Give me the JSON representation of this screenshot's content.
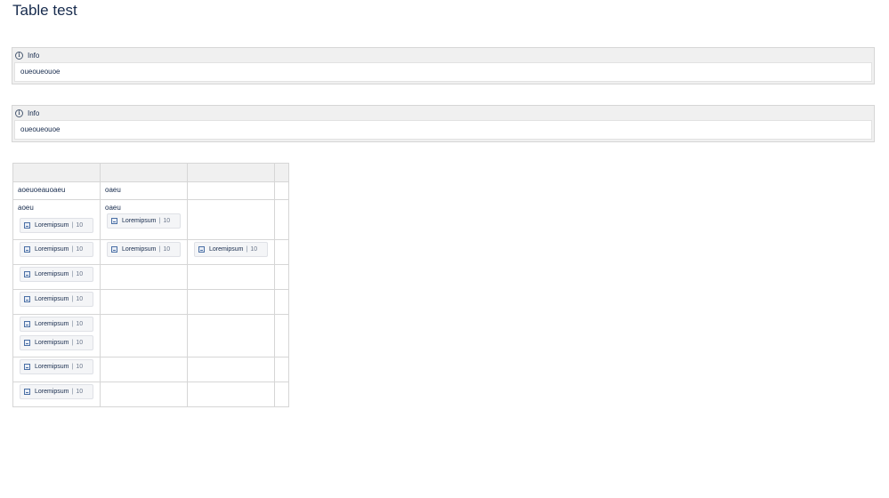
{
  "page": {
    "title": "Table test"
  },
  "panels": [
    {
      "header": "Info",
      "body": "oueoueouoe"
    },
    {
      "header": "Info",
      "body": "oueoueouoe"
    }
  ],
  "table": {
    "rows": [
      {
        "col1_text": "aoeuoeauoaeu",
        "col2_text": "oaeu"
      },
      {
        "col1_text": "aoeu",
        "col2_text": "oaeu"
      }
    ],
    "chip": {
      "label": "Loremipsum",
      "separator": "|",
      "count": "10",
      "icon": "page-icon"
    }
  }
}
